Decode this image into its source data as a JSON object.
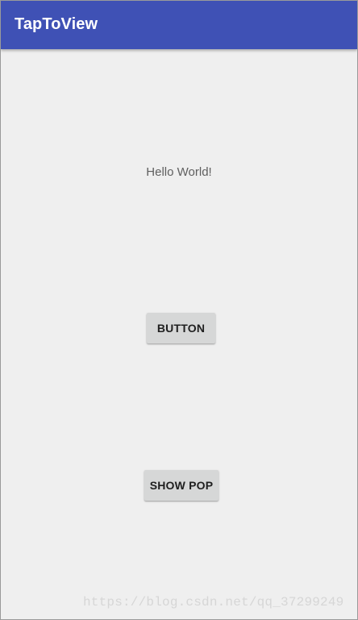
{
  "app_bar": {
    "title": "TapToView",
    "color": "#3f51b5"
  },
  "content": {
    "hello_text": "Hello World!",
    "button_label": "BUTTON",
    "show_pop_label": "SHOW POP"
  },
  "watermark": {
    "text": "https://blog.csdn.net/qq_37299249"
  },
  "colors": {
    "background": "#efefef",
    "button_bg": "#d6d7d7"
  }
}
